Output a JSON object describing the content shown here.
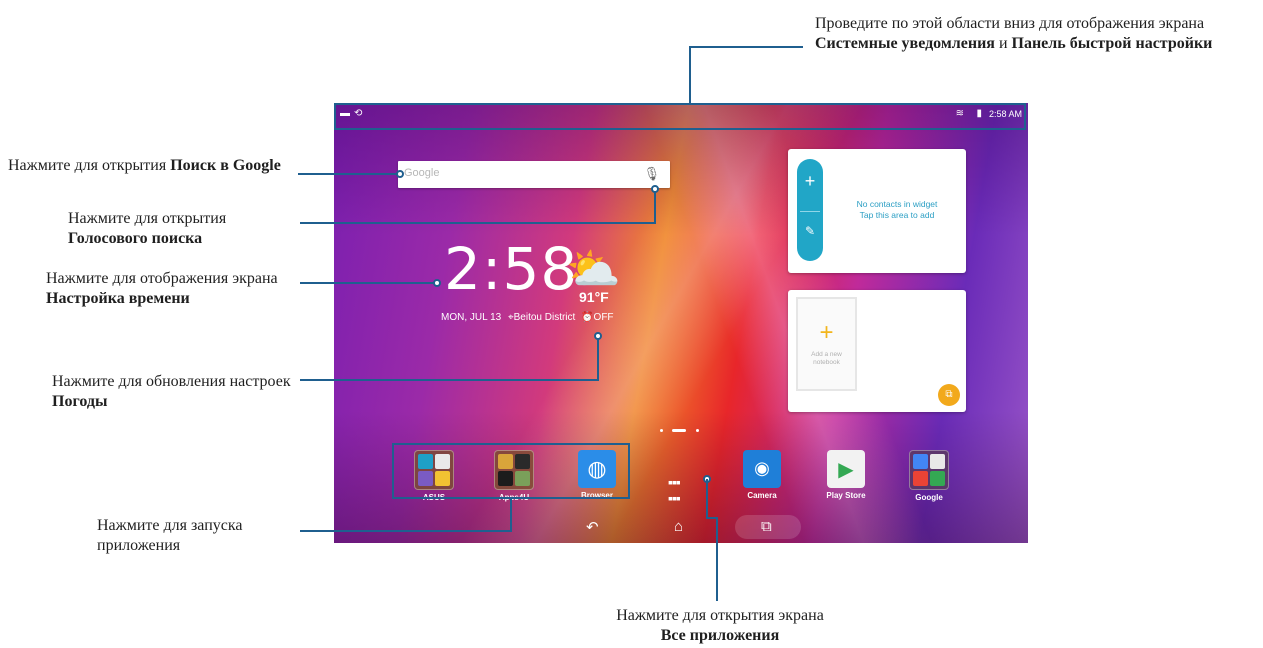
{
  "callouts": {
    "status_area": {
      "pre": "Проведите по этой области вниз для отображения экрана ",
      "b1": "Системные уведомления",
      "mid": " и ",
      "b2": "Панель быстрой настройки"
    },
    "google_search": {
      "pre": "Нажмите для открытия ",
      "b1": "Поиск в Google"
    },
    "voice_search": {
      "pre": "Нажмите для открытия ",
      "b1": "Голосового поиска"
    },
    "time_settings": {
      "pre": "Нажмите для отображения экрана ",
      "b1": "Настройка времени"
    },
    "weather": {
      "pre": "Нажмите для обновления настроек ",
      "b1": "Погоды"
    },
    "launch_app": {
      "pre": "Нажмите для запуска приложения"
    },
    "all_apps": {
      "pre": "Нажмите для открытия экрана ",
      "b1": "Все приложения"
    }
  },
  "statusbar": {
    "time": "2:58 AM"
  },
  "search": {
    "placeholder": "Google"
  },
  "clock": {
    "time": "2:58",
    "temperature": "91°F",
    "date": "MON, JUL 13",
    "location": "Beitou District",
    "alarm": "OFF"
  },
  "contacts_widget": {
    "line1": "No contacts in widget",
    "line2": "Tap this area to add"
  },
  "notebook_widget": {
    "label": "Add a new notebook"
  },
  "dock_left": [
    {
      "label": "ASUS"
    },
    {
      "label": "Apps4U"
    },
    {
      "label": "Browser"
    }
  ],
  "dock_right": [
    {
      "label": "Camera"
    },
    {
      "label": "Play Store"
    },
    {
      "label": "Google"
    }
  ],
  "icons": {
    "all_apps": "grid-icon",
    "back": "back-icon",
    "home": "home-icon",
    "recents": "recents-icon"
  }
}
